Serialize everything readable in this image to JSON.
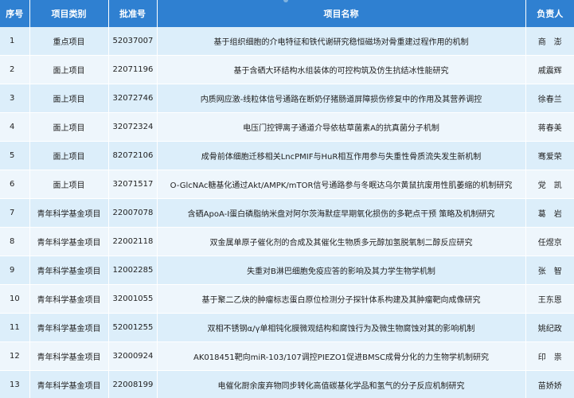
{
  "header": {
    "no": "序号",
    "category": "项目类别",
    "approval_no": "批准号",
    "project_name": "项目名称",
    "leader": "负责人"
  },
  "rows": [
    {
      "no": "1",
      "category": "重点项目",
      "approval_no": "52037007",
      "project_name": "基于组织细胞的介电特征和铁代谢研究稳恒磁场对骨重建过程作用的机制",
      "leader": "商　澎"
    },
    {
      "no": "2",
      "category": "面上项目",
      "approval_no": "22071196",
      "project_name": "基于含硒大环结构水组装体的可控构筑及仿生抗结冰性能研究",
      "leader": "戚震辉"
    },
    {
      "no": "3",
      "category": "面上项目",
      "approval_no": "32072746",
      "project_name": "内质网应激-线粒体信号通路在断奶仔猪肠道屏障损伤修复中的作用及其营养调控",
      "leader": "徐春兰"
    },
    {
      "no": "4",
      "category": "面上项目",
      "approval_no": "32072324",
      "project_name": "电压门控钾离子通道介导依枯草菌素A的抗真菌分子机制",
      "leader": "蒋春美"
    },
    {
      "no": "5",
      "category": "面上项目",
      "approval_no": "82072106",
      "project_name": "成骨前体细胞迁移相关LncPMIF与HuR相互作用参与失重性骨质流失发生新机制",
      "leader": "骞爱荣"
    },
    {
      "no": "6",
      "category": "面上项目",
      "approval_no": "32071517",
      "project_name": "O-GlcNAc糖基化通过Akt/AMPK/mTOR信号通路参与冬眠达乌尔黄鼠抗废用性肌萎缩的机制研究",
      "leader": "党　凯"
    },
    {
      "no": "7",
      "category": "青年科学基金项目",
      "approval_no": "22007078",
      "project_name": "含硒ApoA-I蛋白磷脂纳米盘对阿尔茨海默症早期氧化损伤的多靶点干预 策略及机制研究",
      "leader": "葛　岩"
    },
    {
      "no": "8",
      "category": "青年科学基金项目",
      "approval_no": "22002118",
      "project_name": "双金属单原子催化剂的合成及其催化生物质多元醇加氢脱氧制二醇反应研究",
      "leader": "任煜京"
    },
    {
      "no": "9",
      "category": "青年科学基金项目",
      "approval_no": "12002285",
      "project_name": "失重对B淋巴细胞免疫应答的影响及其力学生物学机制",
      "leader": "张　智"
    },
    {
      "no": "10",
      "category": "青年科学基金项目",
      "approval_no": "32001055",
      "project_name": "基于聚二乙炔的肿瘤标志蛋白原位检测分子探针体系构建及其肿瘤靶向成像研究",
      "leader": "王东恩"
    },
    {
      "no": "11",
      "category": "青年科学基金项目",
      "approval_no": "52001255",
      "project_name": "双相不锈钢α/γ单相钝化膜微观结构和腐蚀行为及微生物腐蚀对其的影响机制",
      "leader": "姚纪政"
    },
    {
      "no": "12",
      "category": "青年科学基金项目",
      "approval_no": "32000924",
      "project_name": "AK018451靶向miR-103/107调控PIEZO1促进BMSC成骨分化的力生物学机制研究",
      "leader": "印　祟"
    },
    {
      "no": "13",
      "category": "青年科学基金项目",
      "approval_no": "22008199",
      "project_name": "电催化厨余废弃物同步转化高值碳基化学品和氢气的分子反应机制研究",
      "leader": "苗娇娇"
    }
  ]
}
